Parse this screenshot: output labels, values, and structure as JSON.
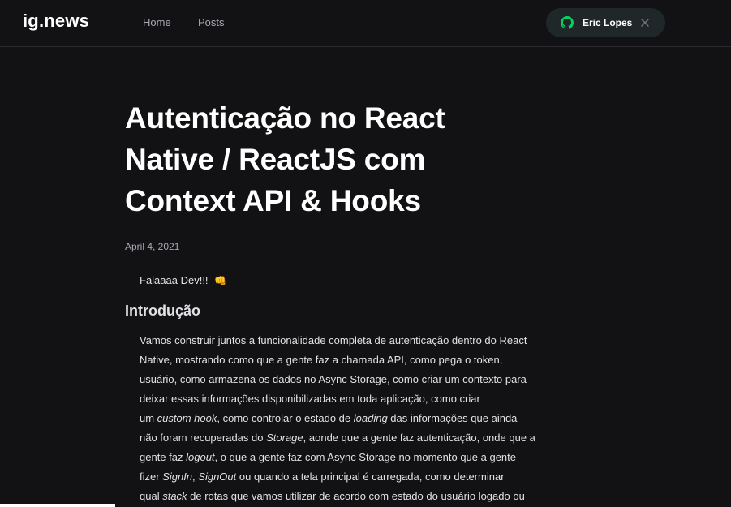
{
  "header": {
    "logo": "ig.news",
    "nav": [
      {
        "label": "Home"
      },
      {
        "label": "Posts"
      }
    ],
    "user": {
      "name": "Eric Lopes",
      "icon": "github-icon",
      "icon_color": "#04d361",
      "close_icon": "close-icon"
    }
  },
  "article": {
    "title_lines": [
      "Autenticação no React",
      "Native / ReactJS com",
      "Context API & Hooks"
    ],
    "date": "April 4, 2021",
    "greeting": "Falaaaa Dev!!!",
    "greeting_emoji": "👊",
    "section_heading": "Introdução",
    "body_lines": [
      {
        "parts": [
          {
            "t": "Vamos construir juntos a funcionalidade completa de autenticação dentro do React"
          }
        ]
      },
      {
        "parts": [
          {
            "t": "Native, mostrando como que a gente faz a chamada API, como pega o token,"
          }
        ]
      },
      {
        "parts": [
          {
            "t": "usuário, como armazena os dados no Async Storage, como criar um contexto para"
          }
        ]
      },
      {
        "parts": [
          {
            "t": "deixar essas informações disponibilizadas em toda aplicação, como  criar"
          }
        ]
      },
      {
        "parts": [
          {
            "t": "um "
          },
          {
            "t": "custom hook",
            "i": true
          },
          {
            "t": ", como controlar o estado de "
          },
          {
            "t": "loading",
            "i": true
          },
          {
            "t": " das informações que ainda"
          }
        ]
      },
      {
        "parts": [
          {
            "t": "não foram recuperadas do "
          },
          {
            "t": "Storage",
            "i": true
          },
          {
            "t": ", aonde que a gente faz autenticação, onde que a"
          }
        ]
      },
      {
        "parts": [
          {
            "t": "gente faz "
          },
          {
            "t": "logout",
            "i": true
          },
          {
            "t": ",  o que a gente faz com Async Storage no momento que a gente"
          }
        ]
      },
      {
        "parts": [
          {
            "t": "fizer "
          },
          {
            "t": "SignIn",
            "i": true
          },
          {
            "t": ", "
          },
          {
            "t": "SignOut",
            "i": true
          },
          {
            "t": " ou quando a tela principal é carregada, como determinar"
          }
        ]
      },
      {
        "parts": [
          {
            "t": "qual "
          },
          {
            "t": "stack",
            "i": true
          },
          {
            "t": " de rotas que vamos utilizar de acordo com estado do usuário logado ou"
          }
        ]
      }
    ]
  },
  "colors": {
    "background": "#121214",
    "border": "#29292e",
    "pill": "#1f2729",
    "accent": "#04d361"
  }
}
